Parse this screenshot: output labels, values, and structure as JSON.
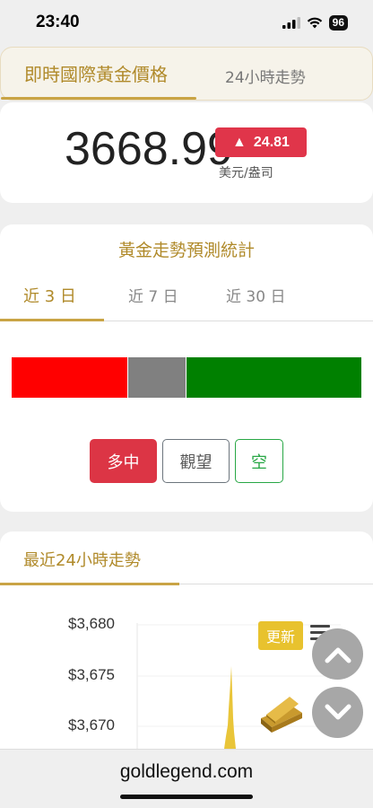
{
  "status_bar": {
    "time": "23:40",
    "battery": "96"
  },
  "header_tabs": {
    "active": "即時國際黃金價格",
    "second": "24小時走勢"
  },
  "price": {
    "value": "3668.99",
    "change_arrow": "▲",
    "change": "24.81",
    "unit": "美元/盎司",
    "change_color": "#e0354a"
  },
  "forecast": {
    "title": "黃金走勢預測統計",
    "periods": [
      "近 3 日",
      "近 7 日",
      "近 30 日"
    ],
    "active_period": "近 3 日",
    "distribution": {
      "long": 0.33,
      "watch": 0.165,
      "short": 0.505
    },
    "buttons": {
      "long": "多中",
      "watch": "觀望",
      "short": "空"
    }
  },
  "trend": {
    "title": "最近24小時走勢",
    "y_ticks": [
      "$3,680",
      "$3,675",
      "$3,670"
    ],
    "update_label": "更新"
  },
  "url": "goldlegend.com",
  "colors": {
    "gold": "#b08a2a",
    "red": "#ff0000",
    "gray": "#808080",
    "green": "#008000"
  }
}
